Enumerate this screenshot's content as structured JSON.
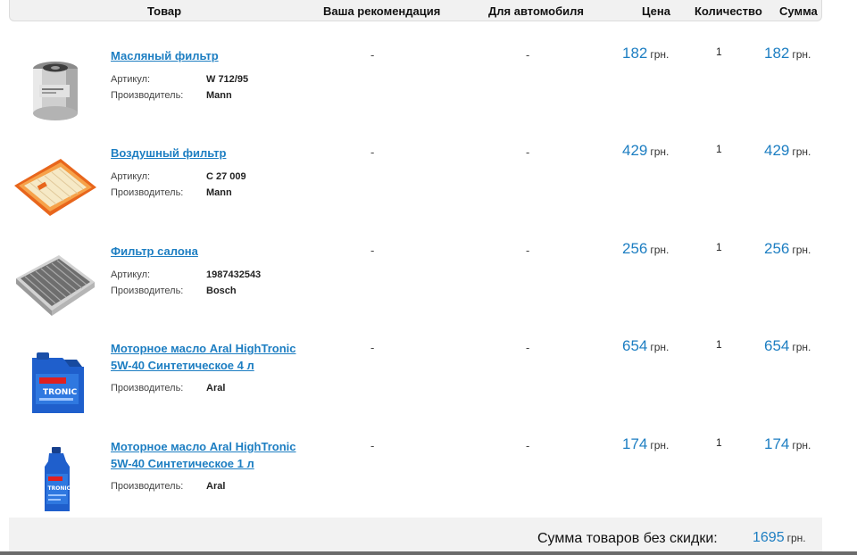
{
  "header": {
    "product": "Товар",
    "recommendation": "Ваша рекомендация",
    "for_car": "Для автомобиля",
    "price": "Цена",
    "quantity": "Количество",
    "sum": "Сумма"
  },
  "labels": {
    "article": "Артикул:",
    "manufacturer": "Производитель:"
  },
  "currency": "грн.",
  "items": [
    {
      "name": "Масляный фильтр",
      "article": "W 712/95",
      "manufacturer": "Mann",
      "recommendation": "-",
      "for_car": "-",
      "price": "182",
      "quantity": "1",
      "sum": "182",
      "icon": "oil-filter-icon"
    },
    {
      "name": "Воздушный фильтр",
      "article": "C 27 009",
      "manufacturer": "Mann",
      "recommendation": "-",
      "for_car": "-",
      "price": "429",
      "quantity": "1",
      "sum": "429",
      "icon": "air-filter-icon"
    },
    {
      "name": "Фильтр салона",
      "article": "1987432543",
      "manufacturer": "Bosch",
      "recommendation": "-",
      "for_car": "-",
      "price": "256",
      "quantity": "1",
      "sum": "256",
      "icon": "cabin-filter-icon"
    },
    {
      "name": "Моторное масло Aral HighTronic 5W-40 Синтетическое 4 л",
      "manufacturer": "Aral",
      "recommendation": "-",
      "for_car": "-",
      "price": "654",
      "quantity": "1",
      "sum": "654",
      "icon": "oil-canister-4l-icon"
    },
    {
      "name": "Моторное масло Aral HighTronic 5W-40 Синтетическое 1 л",
      "manufacturer": "Aral",
      "recommendation": "-",
      "for_car": "-",
      "price": "174",
      "quantity": "1",
      "sum": "174",
      "icon": "oil-bottle-1l-icon"
    }
  ],
  "footer": {
    "label": "Сумма товаров без скидки:",
    "total": "1695"
  },
  "colors": {
    "link": "#1d7ec2",
    "header_bg": "#f1f1f1",
    "footer_bg": "#f2f2f2",
    "oil_blue": "#1f5fcc",
    "air_filter_orange": "#f07d2a"
  }
}
